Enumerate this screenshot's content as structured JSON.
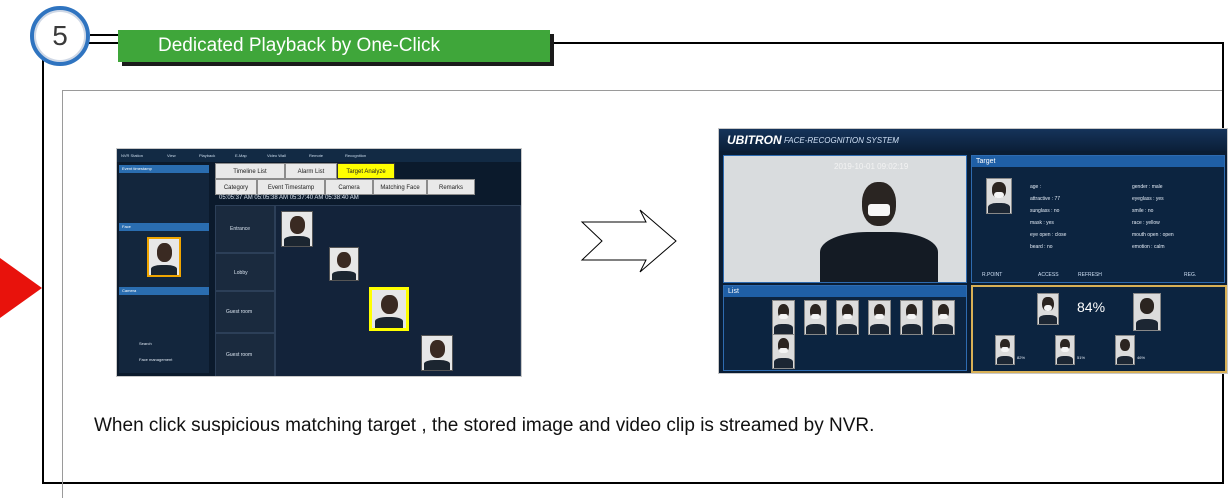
{
  "step": {
    "number": "5",
    "title": "Dedicated Playback by One-Click"
  },
  "caption": "When click suspicious matching target , the stored image and video clip is streamed by NVR.",
  "colors": {
    "accent_green": "#3fa63a",
    "badge_blue": "#2f74c0",
    "alert_red": "#e8120c",
    "highlight_yellow": "#ffff00"
  },
  "nvr": {
    "app_title": "NVR Station",
    "menu": [
      "View",
      "Playback",
      "E-Map",
      "Video Wall",
      "Remote",
      "Recognition"
    ],
    "tabs_row1": [
      "Timeline List",
      "Alarm List",
      "Target Analyze"
    ],
    "tabs_row2": [
      "Category",
      "Event Timestamp",
      "Camera",
      "Matching Face",
      "Remarks"
    ],
    "times": "05:05:37 AM    05:05:38 AM    05:37:40 AM    05:38:40 AM",
    "rooms": [
      "Entrance",
      "Lobby",
      "Guest room",
      "Guest room"
    ],
    "thumb_times": [
      "05:03:37 AM",
      "05:05:17 AM",
      "05:05:28 AM",
      "05:05:37 AM"
    ],
    "left_panels": [
      "Event timestamp",
      "Face",
      "Camera"
    ],
    "buttons": {
      "search": "Search",
      "face_mgmt": "Face management"
    }
  },
  "frs": {
    "logo": "UBITRON",
    "system": "FACE-RECOGNITION SYSTEM",
    "timestamp": "2019-10-01 09:02:19",
    "target_header": "Target",
    "list_header": "List",
    "attributes_left": [
      "age :",
      "attractive : 77",
      "sunglass : no",
      "mask : yes",
      "eye open : close",
      "beard : no"
    ],
    "attributes_right": [
      "gender : male",
      "eyeglass : yes",
      "smile : no",
      "race : yellow",
      "mouth open : open",
      "emotion : calm"
    ],
    "stat_headers": [
      "R.POINT",
      "ACCESS",
      "REFRESH",
      "REG."
    ],
    "match_percent": "84%",
    "small_percents": [
      "82%",
      "51%",
      "46%"
    ]
  }
}
